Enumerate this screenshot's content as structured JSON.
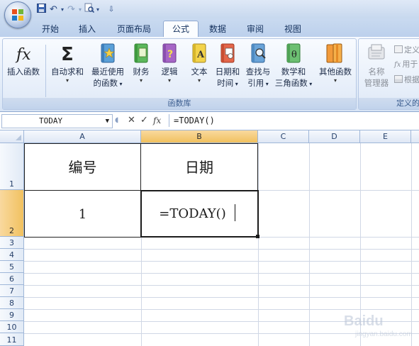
{
  "app": {
    "tabs": [
      {
        "label": "开始"
      },
      {
        "label": "插入"
      },
      {
        "label": "页面布局"
      },
      {
        "label": "公式",
        "active": true
      },
      {
        "label": "数据"
      },
      {
        "label": "审阅"
      },
      {
        "label": "视图"
      }
    ]
  },
  "ribbon": {
    "function_library": {
      "label": "函数库",
      "buttons": [
        {
          "line1": "插入函数",
          "line2": "",
          "icon": "fx-icon"
        },
        {
          "line1": "自动求和",
          "line2": "",
          "icon": "sigma-icon",
          "dropdown": true
        },
        {
          "line1": "最近使用",
          "line2": "的函数",
          "icon": "star-book-icon",
          "dropdown": true
        },
        {
          "line1": "财务",
          "line2": "",
          "icon": "finance-book-icon",
          "dropdown": true
        },
        {
          "line1": "逻辑",
          "line2": "",
          "icon": "logic-book-icon",
          "dropdown": true
        },
        {
          "line1": "文本",
          "line2": "",
          "icon": "text-book-icon",
          "dropdown": true
        },
        {
          "line1": "日期和",
          "line2": "时间",
          "icon": "datetime-book-icon",
          "dropdown": true
        },
        {
          "line1": "查找与",
          "line2": "引用",
          "icon": "lookup-book-icon",
          "dropdown": true
        },
        {
          "line1": "数学和",
          "line2": "三角函数",
          "icon": "math-book-icon",
          "dropdown": true
        },
        {
          "line1": "其他函数",
          "line2": "",
          "icon": "more-book-icon",
          "dropdown": true
        }
      ]
    },
    "defined_names": {
      "label": "定义的",
      "name_manager": {
        "line1": "名称",
        "line2": "管理器"
      },
      "small": [
        "定义",
        "用于",
        "根据"
      ]
    }
  },
  "formula_bar": {
    "name_box": "TODAY",
    "formula": "=TODAY()"
  },
  "grid": {
    "columns": [
      "A",
      "B",
      "C",
      "D",
      "E"
    ],
    "rows": [
      "1",
      "2",
      "3",
      "4",
      "5",
      "6",
      "7",
      "8",
      "9",
      "10",
      "11"
    ],
    "cells": {
      "A1": "编号",
      "B1": "日期",
      "A2": "1",
      "B2": "=TODAY()"
    },
    "selected_column": "B",
    "selected_row": "2"
  },
  "colors": {
    "selection_header": "#f1c15f",
    "ribbon_text": "#1d2c48",
    "tab_text": "#15325e"
  },
  "watermark": {
    "text": "Baidu",
    "sub": "jingyan.baidu.com"
  }
}
